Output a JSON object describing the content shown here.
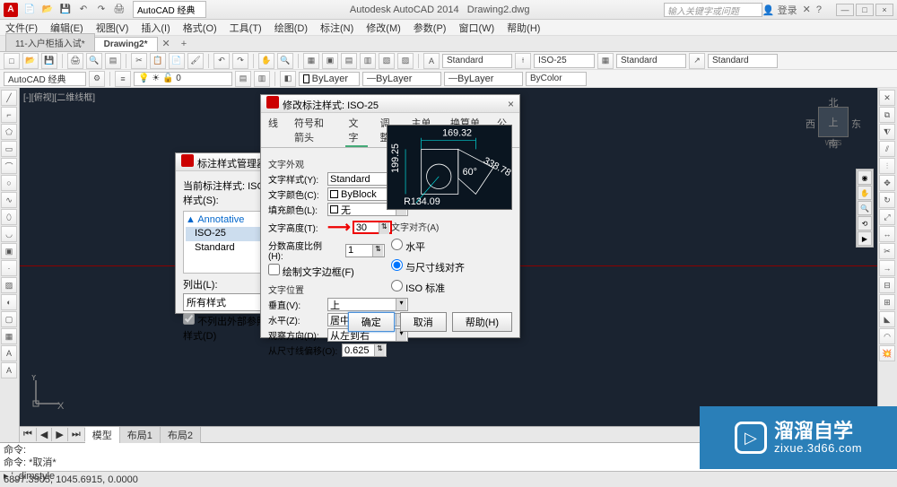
{
  "titlebar": {
    "app_title": "Autodesk AutoCAD 2014",
    "doc_title": "Drawing2.dwg",
    "workspace": "AutoCAD 经典",
    "search_placeholder": "输入关键字或问题",
    "login": "登录",
    "win_min": "—",
    "win_max": "□",
    "win_close": "×"
  },
  "menu": {
    "items": [
      "文件(F)",
      "编辑(E)",
      "视图(V)",
      "插入(I)",
      "格式(O)",
      "工具(T)",
      "绘图(D)",
      "标注(N)",
      "修改(M)",
      "参数(P)",
      "窗口(W)",
      "帮助(H)"
    ]
  },
  "doctabs": {
    "tabs": [
      {
        "label": "11-入户柜插入试*",
        "active": false
      },
      {
        "label": "Drawing2*",
        "active": true
      }
    ]
  },
  "toolbars": {
    "style_combo1": "Standard",
    "style_combo2": "ISO-25",
    "style_combo3": "Standard",
    "style_combo4": "Standard",
    "layer_combo": "ByLayer",
    "linetype_combo": "ByLayer",
    "lineweight_combo": "ByLayer",
    "color_combo": "ByColor",
    "ws_small": "AutoCAD 经典"
  },
  "canvas": {
    "view_label": "[-][俯视][二维线框]",
    "tabs": [
      "模型",
      "布局1",
      "布局2"
    ],
    "ucs_y": "Y",
    "ucs_x": "X",
    "viewcube": {
      "top": "上",
      "n": "北",
      "s": "南",
      "e": "东",
      "w": "西",
      "wcs": "WCS"
    }
  },
  "cmdline": {
    "line1": "命令:",
    "line2": "命令: *取消*",
    "line3": "▸ '_dimstyle"
  },
  "statusbar": {
    "coords": "6897.3905, 1045.6915, 0.0000"
  },
  "dlg_style_mgr": {
    "title": "标注样式管理器",
    "current_label": "当前标注样式: ISO-25",
    "styles_label": "样式(S):",
    "tree": {
      "n1": "Annotative",
      "n2": "ISO-25",
      "n3": "Standard"
    },
    "list_label": "列出(L):",
    "list_value": "所有样式",
    "chk_external": "不列出外部参照中的样式(D)"
  },
  "dlg_modify": {
    "title": "修改标注样式: ISO-25",
    "tabs": [
      "线",
      "符号和箭头",
      "文字",
      "调整",
      "主单位",
      "换算单位",
      "公差"
    ],
    "active_tab": 2,
    "group_appearance": "文字外观",
    "text_style_label": "文字样式(Y):",
    "text_style_value": "Standard",
    "text_color_label": "文字颜色(C):",
    "text_color_value": "ByBlock",
    "fill_color_label": "填充颜色(L):",
    "fill_color_value": "无",
    "text_height_label": "文字高度(T):",
    "text_height_value": "30",
    "fraction_label": "分数高度比例(H):",
    "fraction_value": "1",
    "frame_chk": "绘制文字边框(F)",
    "group_placement": "文字位置",
    "vertical_label": "垂直(V):",
    "vertical_value": "上",
    "horizontal_label": "水平(Z):",
    "horizontal_value": "居中",
    "view_dir_label": "观察方向(D):",
    "view_dir_value": "从左到右",
    "offset_label": "从尺寸线偏移(O):",
    "offset_value": "0.625",
    "group_align": "文字对齐(A)",
    "align_horiz": "水平",
    "align_dim": "与尺寸线对齐",
    "align_iso": "ISO 标准",
    "preview_dims": {
      "top": "169.32",
      "left": "199.25",
      "bottom": "R134.09",
      "angle": "60°",
      "diag": "338.78"
    },
    "btn_ok": "确定",
    "btn_cancel": "取消",
    "btn_help": "帮助(H)"
  },
  "watermark": {
    "big": "溜溜自学",
    "small": "zixue.3d66.com"
  }
}
